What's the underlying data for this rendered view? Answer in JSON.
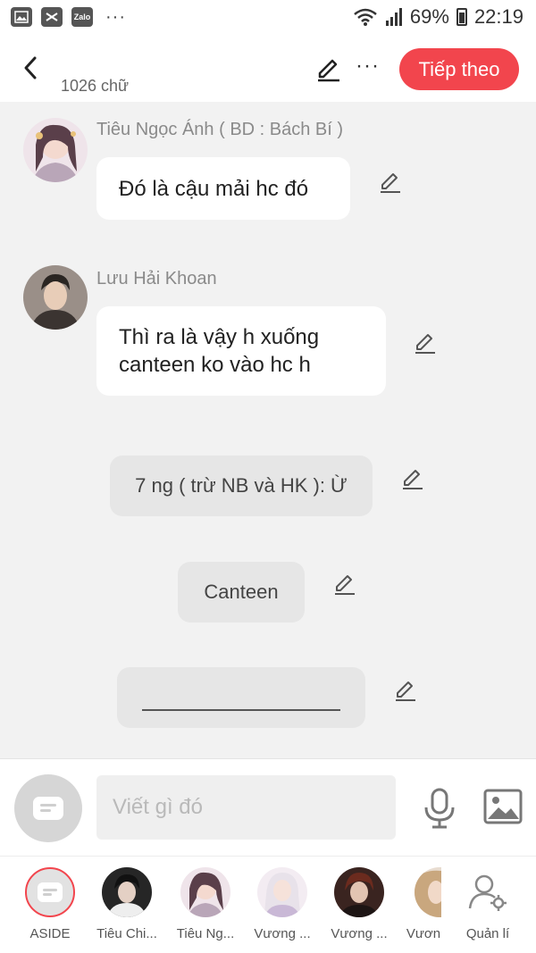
{
  "status_bar": {
    "battery": "69%",
    "time": "22:19",
    "left_icons": [
      "gallery-icon",
      "capcut-icon",
      "zalo-icon"
    ],
    "zalo_label": "Zalo"
  },
  "header": {
    "word_count": "1026 chữ",
    "next_label": "Tiếp theo"
  },
  "messages": [
    {
      "type": "character",
      "name": "Tiêu Ngọc Ánh ( BD : Bách Bí )",
      "text": "Đó là cậu mải hc đó"
    },
    {
      "type": "character",
      "name": "Lưu Hải Khoan",
      "line1": "Thì ra là vậy h xuống",
      "line2": "canteen ko vào hc h"
    },
    {
      "type": "aside",
      "text": "7 ng ( trừ NB và HK ): Ừ"
    },
    {
      "type": "aside",
      "text": "Canteen"
    },
    {
      "type": "aside",
      "text": ""
    }
  ],
  "input": {
    "placeholder": "Viết gì đó"
  },
  "characters": [
    {
      "label": "ASIDE"
    },
    {
      "label": "Tiêu Chi..."
    },
    {
      "label": "Tiêu Ng..."
    },
    {
      "label": "Vương ..."
    },
    {
      "label": "Vương ..."
    },
    {
      "label": "Vươn"
    },
    {
      "label": "Quản lí"
    }
  ],
  "colors": {
    "accent": "#f2454d",
    "background": "#f2f2f2",
    "bubble": "#ffffff",
    "aside_bubble": "#e6e6e6"
  }
}
